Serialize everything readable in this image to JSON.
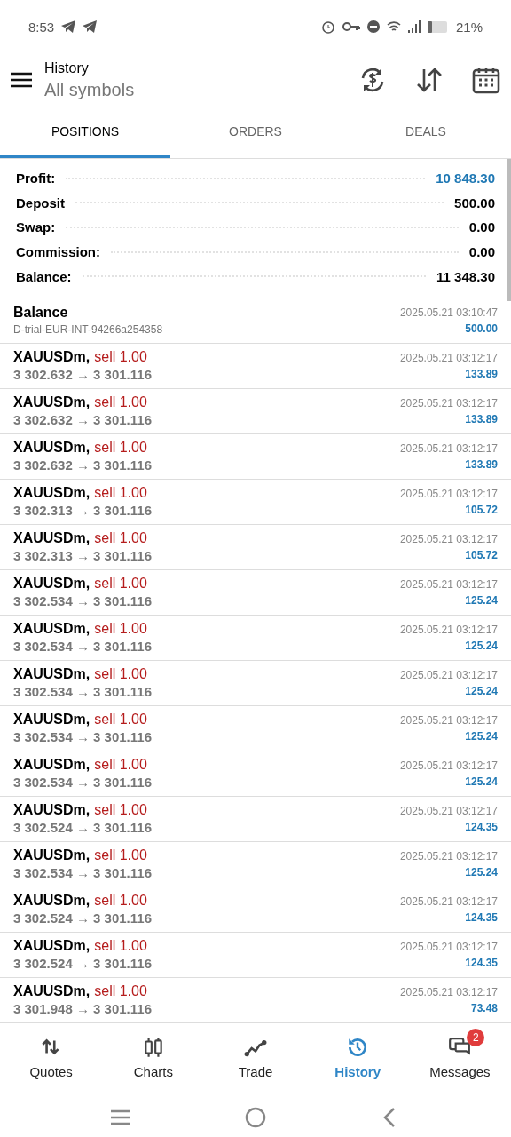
{
  "status_bar": {
    "time": "8:53",
    "battery": "21%"
  },
  "header": {
    "title": "History",
    "subtitle": "All symbols"
  },
  "tabs": [
    {
      "label": "POSITIONS",
      "selected": true
    },
    {
      "label": "ORDERS",
      "selected": false
    },
    {
      "label": "DEALS",
      "selected": false
    }
  ],
  "summary": [
    {
      "label": "Profit:",
      "value": "10 848.30",
      "color": "#1f78b4"
    },
    {
      "label": "Deposit",
      "value": "500.00",
      "color": "#000000"
    },
    {
      "label": "Swap:",
      "value": "0.00",
      "color": "#000000"
    },
    {
      "label": "Commission:",
      "value": "0.00",
      "color": "#000000"
    },
    {
      "label": "Balance:",
      "value": "11 348.30",
      "color": "#000000"
    }
  ],
  "rows": [
    {
      "kind": "balance",
      "title": "Balance",
      "detail": "D-trial-EUR-INT-94266a254358",
      "time": "2025.05.21 03:10:47",
      "amount": "500.00"
    },
    {
      "kind": "trade",
      "symbol": "XAUUSDm,",
      "deal": "sell 1.00",
      "prices": "3 302.632 → 3 301.116",
      "time": "2025.05.21 03:12:17",
      "amount": "133.89"
    },
    {
      "kind": "trade",
      "symbol": "XAUUSDm,",
      "deal": "sell 1.00",
      "prices": "3 302.632 → 3 301.116",
      "time": "2025.05.21 03:12:17",
      "amount": "133.89"
    },
    {
      "kind": "trade",
      "symbol": "XAUUSDm,",
      "deal": "sell 1.00",
      "prices": "3 302.632 → 3 301.116",
      "time": "2025.05.21 03:12:17",
      "amount": "133.89"
    },
    {
      "kind": "trade",
      "symbol": "XAUUSDm,",
      "deal": "sell 1.00",
      "prices": "3 302.313 → 3 301.116",
      "time": "2025.05.21 03:12:17",
      "amount": "105.72"
    },
    {
      "kind": "trade",
      "symbol": "XAUUSDm,",
      "deal": "sell 1.00",
      "prices": "3 302.313 → 3 301.116",
      "time": "2025.05.21 03:12:17",
      "amount": "105.72"
    },
    {
      "kind": "trade",
      "symbol": "XAUUSDm,",
      "deal": "sell 1.00",
      "prices": "3 302.534 → 3 301.116",
      "time": "2025.05.21 03:12:17",
      "amount": "125.24"
    },
    {
      "kind": "trade",
      "symbol": "XAUUSDm,",
      "deal": "sell 1.00",
      "prices": "3 302.534 → 3 301.116",
      "time": "2025.05.21 03:12:17",
      "amount": "125.24"
    },
    {
      "kind": "trade",
      "symbol": "XAUUSDm,",
      "deal": "sell 1.00",
      "prices": "3 302.534 → 3 301.116",
      "time": "2025.05.21 03:12:17",
      "amount": "125.24"
    },
    {
      "kind": "trade",
      "symbol": "XAUUSDm,",
      "deal": "sell 1.00",
      "prices": "3 302.534 → 3 301.116",
      "time": "2025.05.21 03:12:17",
      "amount": "125.24"
    },
    {
      "kind": "trade",
      "symbol": "XAUUSDm,",
      "deal": "sell 1.00",
      "prices": "3 302.534 → 3 301.116",
      "time": "2025.05.21 03:12:17",
      "amount": "125.24"
    },
    {
      "kind": "trade",
      "symbol": "XAUUSDm,",
      "deal": "sell 1.00",
      "prices": "3 302.524 → 3 301.116",
      "time": "2025.05.21 03:12:17",
      "amount": "124.35"
    },
    {
      "kind": "trade",
      "symbol": "XAUUSDm,",
      "deal": "sell 1.00",
      "prices": "3 302.534 → 3 301.116",
      "time": "2025.05.21 03:12:17",
      "amount": "125.24"
    },
    {
      "kind": "trade",
      "symbol": "XAUUSDm,",
      "deal": "sell 1.00",
      "prices": "3 302.524 → 3 301.116",
      "time": "2025.05.21 03:12:17",
      "amount": "124.35"
    },
    {
      "kind": "trade",
      "symbol": "XAUUSDm,",
      "deal": "sell 1.00",
      "prices": "3 302.524 → 3 301.116",
      "time": "2025.05.21 03:12:17",
      "amount": "124.35"
    },
    {
      "kind": "trade",
      "symbol": "XAUUSDm,",
      "deal": "sell 1.00",
      "prices": "3 301.948 → 3 301.116",
      "time": "2025.05.21 03:12:17",
      "amount": "73.48"
    }
  ],
  "bottom_nav": [
    {
      "label": "Quotes",
      "selected": false
    },
    {
      "label": "Charts",
      "selected": false
    },
    {
      "label": "Trade",
      "selected": false
    },
    {
      "label": "History",
      "selected": true
    },
    {
      "label": "Messages",
      "selected": false,
      "badge": "2"
    }
  ]
}
